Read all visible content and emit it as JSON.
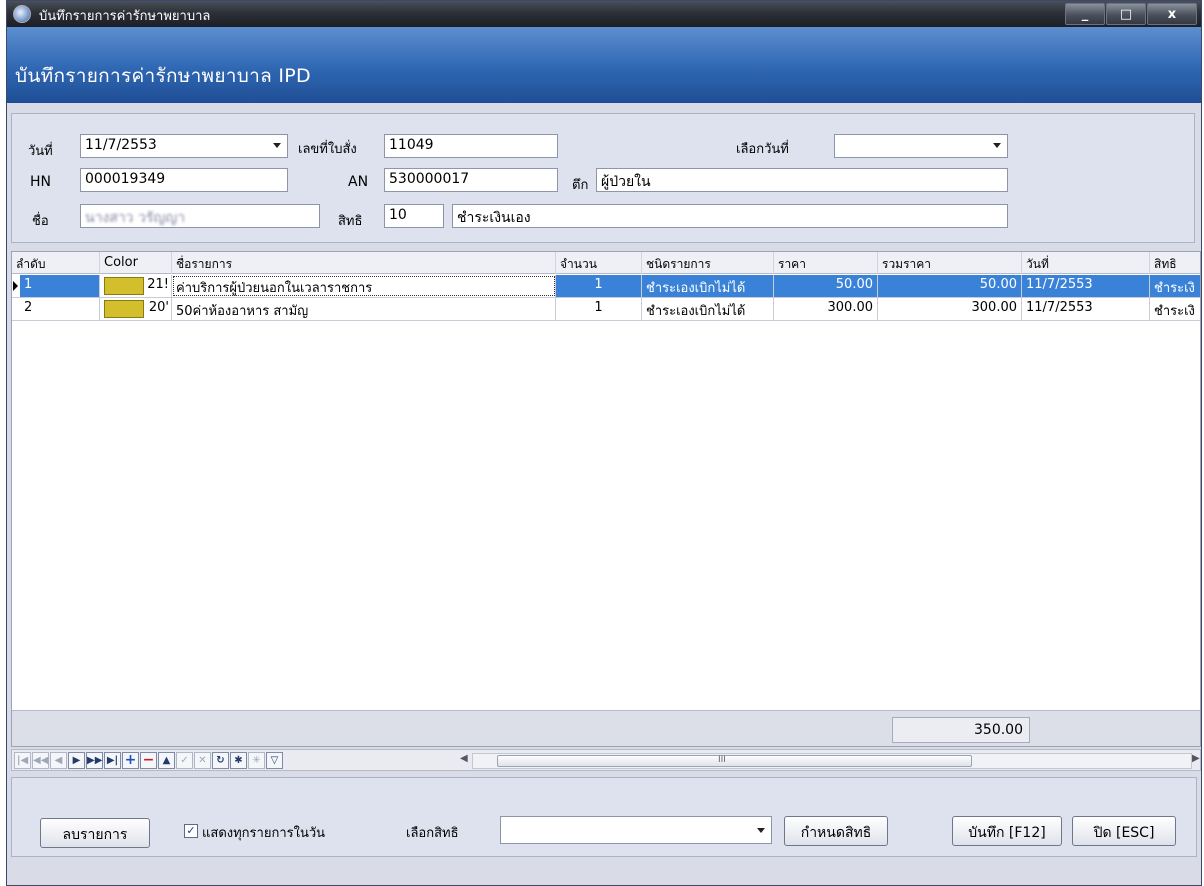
{
  "window": {
    "title": "บันทึกรายการค่ารักษาพยาบาล",
    "min_label": "_",
    "max_label": "□",
    "close_label": "x"
  },
  "header": {
    "title": "บันทึกรายการค่ารักษาพยาบาล IPD"
  },
  "form": {
    "date_label": "วันที่",
    "date_value": "11/7/2553",
    "order_label": "เลขที่ใบสั่ง",
    "order_value": "11049",
    "pick_date_label": "เลือกวันที่",
    "pick_date_value": "",
    "hn_label": "HN",
    "hn_value": "000019349",
    "an_label": "AN",
    "an_value": "530000017",
    "ward_label": "ตึก",
    "ward_value": "ผู้ป่วยใน",
    "name_label": "ชื่อ",
    "name_value": "นางสาว วรัญญา",
    "right_label": "สิทธิ",
    "right_code": "10",
    "right_name": "ชำระเงินเอง"
  },
  "grid": {
    "columns": [
      "ลำดับ",
      "Color",
      "ชื่อรายการ",
      "จำนวน",
      "ชนิดรายการ",
      "ราคา",
      "รวมราคา",
      "วันที่",
      "สิทธิ"
    ],
    "rows": [
      {
        "seq": "1",
        "code": "21!",
        "item": "ค่าบริการผู้ป่วยนอกในเวลาราชการ",
        "qty": "1",
        "type": "ชำระเองเบิกไม่ได้",
        "price": "50.00",
        "total": "50.00",
        "date": "11/7/2553",
        "right": "ชำระเงิ"
      },
      {
        "seq": "2",
        "code": "20'",
        "item": "50ค่าห้องอาหาร สามัญ",
        "qty": "1",
        "type": "ชำระเองเบิกไม่ได้",
        "price": "300.00",
        "total": "300.00",
        "date": "11/7/2553",
        "right": "ชำระเงิ"
      }
    ],
    "footer_total": "350.00",
    "swatch_color": "#d3bf2c"
  },
  "navigator": {
    "scroll_grip": "III"
  },
  "bottom": {
    "delete_button": "ลบรายการ",
    "show_all_label": "แสดงทุกรายการในวัน",
    "show_all_checked": "✓",
    "select_right_label": "เลือกสิทธิ",
    "select_right_value": "",
    "assign_right_button": "กำหนดสิทธิ",
    "save_button": "บันทึก [F12]",
    "close_button": "ปิด [ESC]"
  }
}
